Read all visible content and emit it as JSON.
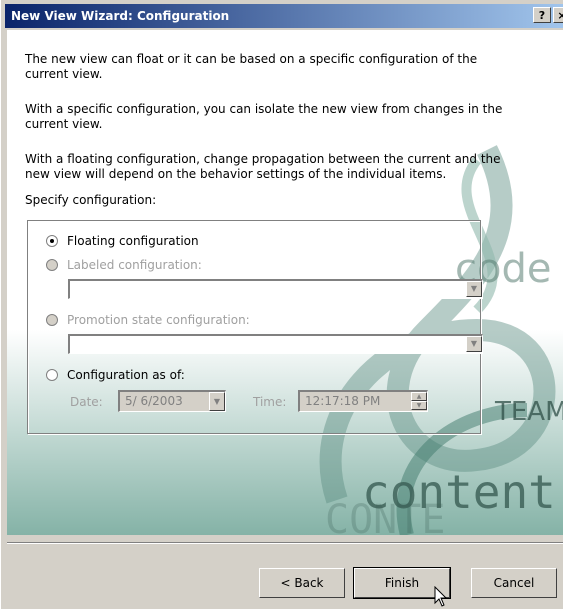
{
  "window": {
    "title": "New View Wizard: Configuration",
    "help_label": "?",
    "close_label": "×"
  },
  "intro": {
    "para1": "The new view can float or it can be based on a specific configuration of the current view.",
    "para2": "With a specific configuration, you can isolate the new view from changes in the current view.",
    "para3": "With a floating configuration, change propagation between the current and the new view will depend on the behavior settings of the individual items.",
    "specify_label": "Specify configuration:"
  },
  "options": {
    "floating": {
      "label": "Floating configuration",
      "selected": true
    },
    "labeled": {
      "label": "Labeled configuration:",
      "value": ""
    },
    "promotion": {
      "label": "Promotion state configuration:",
      "value": ""
    },
    "as_of": {
      "label": "Configuration as of:"
    }
  },
  "date_time": {
    "date_label": "Date:",
    "date_value": "5/ 6/2003",
    "time_label": "Time:",
    "time_value": "12:17:18 PM"
  },
  "background_text": {
    "code": "code",
    "team": "TEAM",
    "content": "content",
    "content_faded": "CONTE"
  },
  "buttons": {
    "back": "< Back",
    "finish": "Finish",
    "cancel": "Cancel"
  }
}
